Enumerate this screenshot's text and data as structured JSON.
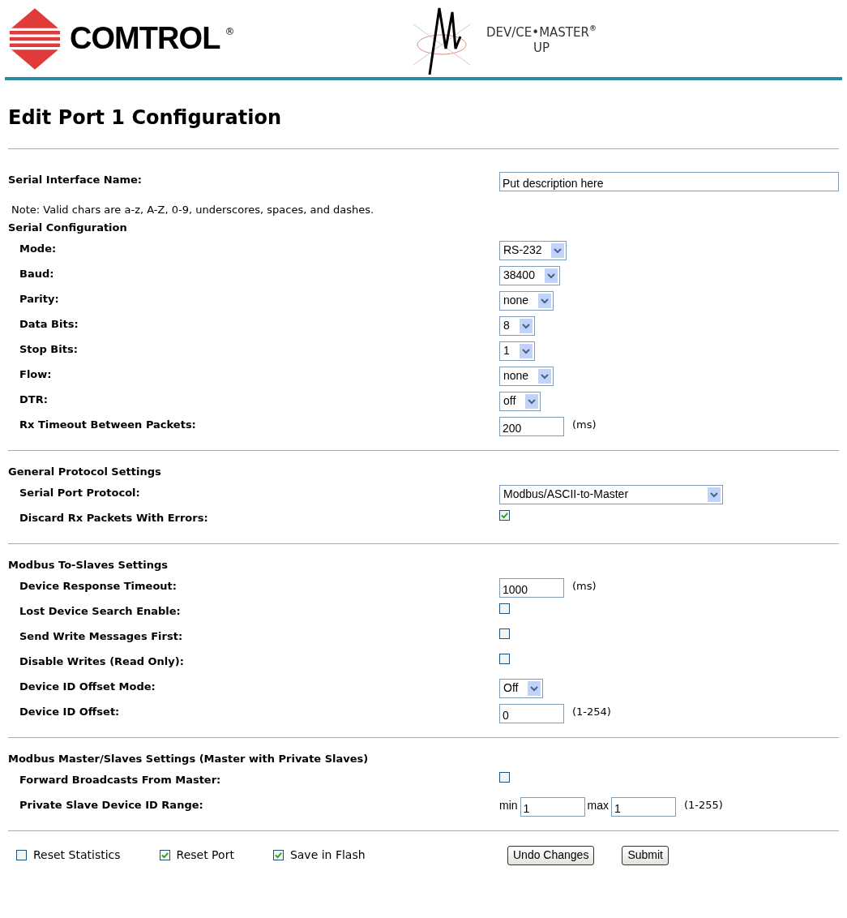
{
  "header": {
    "brand": "COMTROL",
    "brand_mark": "®",
    "product": "DEV/CE•MASTER",
    "product_mark": "®",
    "product_sub": "UP"
  },
  "title": "Edit Port 1 Configuration",
  "sections": [
    {
      "items": [
        {
          "kind": "text",
          "label": "Serial Interface Name:",
          "value": "Put description here"
        },
        {
          "kind": "note",
          "text": "Note: Valid chars are a-z, A-Z, 0-9, underscores, spaces, and dashes."
        },
        {
          "kind": "group",
          "heading": "Serial Configuration",
          "rows": [
            {
              "kind": "select",
              "label": "Mode:",
              "value": "RS-232"
            },
            {
              "kind": "select",
              "label": "Baud:",
              "value": "38400"
            },
            {
              "kind": "select",
              "label": "Parity:",
              "value": "none"
            },
            {
              "kind": "select",
              "label": "Data Bits:",
              "value": "8"
            },
            {
              "kind": "select",
              "label": "Stop Bits:",
              "value": "1"
            },
            {
              "kind": "select",
              "label": "Flow:",
              "value": "none"
            },
            {
              "kind": "select",
              "label": "DTR:",
              "value": "off"
            },
            {
              "kind": "text",
              "label": "Rx Timeout Between Packets:",
              "value": "200",
              "suffix": "(ms)"
            }
          ]
        }
      ]
    },
    {
      "items": [
        {
          "kind": "group",
          "heading": "General Protocol Settings",
          "rows": [
            {
              "kind": "select",
              "label": "Serial Port Protocol:",
              "value": "Modbus/ASCII-to-Master"
            },
            {
              "kind": "checkbox",
              "label": "Discard Rx Packets With Errors:",
              "checked": true
            }
          ]
        }
      ]
    },
    {
      "items": [
        {
          "kind": "group",
          "heading": "Modbus To-Slaves Settings",
          "rows": [
            {
              "kind": "text",
              "label": "Device Response Timeout:",
              "value": "1000",
              "suffix": "(ms)"
            },
            {
              "kind": "checkbox",
              "label": "Lost Device Search Enable:",
              "checked": false
            },
            {
              "kind": "checkbox",
              "label": "Send Write Messages First:",
              "checked": false
            },
            {
              "kind": "checkbox",
              "label": "Disable Writes (Read Only):",
              "checked": false
            },
            {
              "kind": "select",
              "label": "Device ID Offset Mode:",
              "value": "Off"
            },
            {
              "kind": "text",
              "label": "Device ID Offset:",
              "value": "0",
              "suffix": "(1-254)"
            }
          ]
        }
      ]
    },
    {
      "items": [
        {
          "kind": "group",
          "heading": "Modbus Master/Slaves Settings (Master with Private Slaves)",
          "rows": [
            {
              "kind": "checkbox",
              "label": "Forward Broadcasts From Master:",
              "checked": false
            },
            {
              "kind": "range",
              "label": "Private Slave Device ID Range:",
              "min_label": "min",
              "min": "1",
              "max_label": "max",
              "max": "1",
              "suffix": "(1-255)"
            }
          ]
        }
      ]
    }
  ],
  "footer": {
    "options": [
      {
        "label": "Reset Statistics",
        "checked": false
      },
      {
        "label": "Reset Port",
        "checked": true
      },
      {
        "label": "Save in Flash",
        "checked": true
      }
    ],
    "buttons": [
      "Undo Changes",
      "Submit"
    ]
  }
}
